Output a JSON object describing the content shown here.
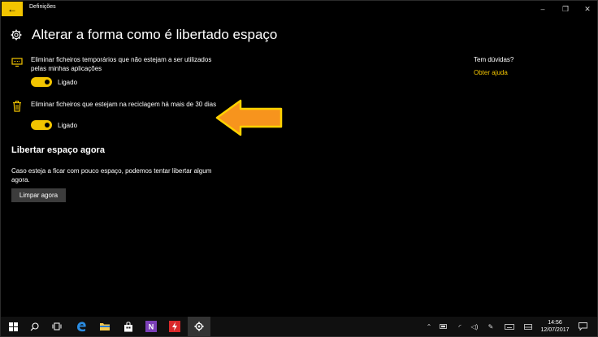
{
  "window": {
    "title": "Definições",
    "back_icon": "←",
    "minimize": "–",
    "maximize": "❐",
    "close": "✕"
  },
  "page": {
    "title": "Alterar a forma como é libertado espaço"
  },
  "settings": [
    {
      "icon": "monitor-icon",
      "text": "Eliminar ficheiros temporários que não estejam a ser utilizados pelas minhas aplicações",
      "toggle_on": true,
      "toggle_label": "Ligado"
    },
    {
      "icon": "recycle-bin-icon",
      "text": "Eliminar ficheiros que estejam na reciclagem há mais de 30 dias",
      "toggle_on": true,
      "toggle_label": "Ligado"
    }
  ],
  "free_now": {
    "heading": "Libertar espaço agora",
    "description": "Caso esteja a ficar com pouco espaço, podemos tentar libertar algum agora.",
    "button_label": "Limpar agora"
  },
  "help": {
    "question": "Tem dúvidas?",
    "link": "Obter ajuda"
  },
  "taskbar": {
    "clock_time": "14:56",
    "clock_date": "12/07/2017"
  },
  "colors": {
    "accent": "#f2c400",
    "arrow_fill": "#f7941d",
    "arrow_outline": "#ffd200"
  }
}
